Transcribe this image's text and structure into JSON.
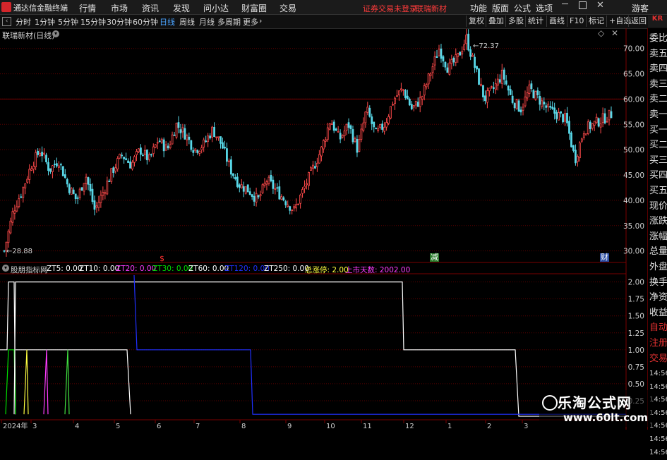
{
  "app": {
    "title": "通达信金融终端"
  },
  "menu": [
    "行情",
    "市场",
    "资讯",
    "发现",
    "问小达",
    "财富圈",
    "交易"
  ],
  "status_warning": "证券交易未登录",
  "stock_link": "联瑞新材",
  "right_menu": [
    "功能",
    "版面",
    "公式",
    "选项"
  ],
  "user": "游客",
  "periods": [
    "分时",
    "1分钟",
    "5分钟",
    "15分钟",
    "30分钟",
    "60分钟",
    "日线",
    "周线",
    "月线",
    "多周期",
    "更多"
  ],
  "active_period": "日线",
  "tools": [
    "复权",
    "叠加",
    "多股",
    "统计",
    "画线",
    "F10",
    "标记",
    "+自选",
    "返回"
  ],
  "chart_title": "联瑞新材(日线)",
  "price_axis": [
    "70.00",
    "65.00",
    "60.00",
    "55.00",
    "50.00",
    "45.00",
    "40.00",
    "35.00",
    "30.00"
  ],
  "high_label": "72.37",
  "low_label": "28.88",
  "markers": {
    "s": "$",
    "jian": "减",
    "cai": "财"
  },
  "indicator": {
    "name": "股朋指标网",
    "items": [
      {
        "label": "ZT5: 0.00",
        "color": "#ffffff"
      },
      {
        "label": "ZT10: 0.00",
        "color": "#ffffff"
      },
      {
        "label": "ZT20: 0.00",
        "color": "#ff3cff"
      },
      {
        "label": "ZT30: 0.00",
        "color": "#00e000"
      },
      {
        "label": "ZT60: 0.00",
        "color": "#ffffff"
      },
      {
        "label": "ZT120: 0.00",
        "color": "#2030ff"
      },
      {
        "label": "ZT250: 0.00",
        "color": "#ffffff"
      },
      {
        "label": "总涨停: 2.00",
        "color": "#ffff40"
      },
      {
        "label": "上市天数: 2002.00",
        "color": "#ff3cff"
      }
    ],
    "axis": [
      "2.00",
      "1.75",
      "1.50",
      "1.25",
      "1.00",
      "0.75",
      "0.50",
      "0.25"
    ]
  },
  "x_axis": [
    "2024年",
    "3",
    "4",
    "5",
    "6",
    "7",
    "8",
    "9",
    "10",
    "11",
    "12",
    "1",
    "2",
    "3"
  ],
  "right_panel": [
    "KR",
    "委比",
    "卖五",
    "卖四",
    "卖三",
    "卖二",
    "卖一",
    "买一",
    "买二",
    "买三",
    "买四",
    "买五",
    "现价",
    "涨跌",
    "涨幅",
    "总量",
    "外盘",
    "换手",
    "净资",
    "收益",
    "自动",
    "注册",
    "交易",
    "14:56",
    "14:56",
    "14:56",
    "14:56",
    "14:56",
    "14:56",
    "14:56"
  ],
  "watermark": {
    "line1": "乐淘公式网",
    "line2": "www.60lt.com"
  },
  "chart_data": {
    "type": "candlestick",
    "title": "联瑞新材(日线)",
    "ylim": [
      28,
      74
    ],
    "close_path": [
      30.0,
      38,
      42,
      47,
      50,
      46,
      48,
      43,
      40,
      45,
      38,
      42,
      46,
      49,
      47,
      50,
      48,
      52,
      50,
      55,
      53,
      50,
      51,
      54,
      51,
      46,
      43,
      42,
      40,
      44,
      42,
      40,
      38,
      42,
      46,
      50,
      56,
      52,
      55,
      50,
      58,
      53,
      55,
      60,
      62,
      58,
      60,
      65,
      70,
      66,
      68,
      72,
      66,
      60,
      62,
      65,
      60,
      58,
      62,
      60,
      58,
      57,
      56,
      48,
      54,
      55,
      56,
      57
    ],
    "indicator_ylim": [
      0,
      2.1
    ]
  }
}
